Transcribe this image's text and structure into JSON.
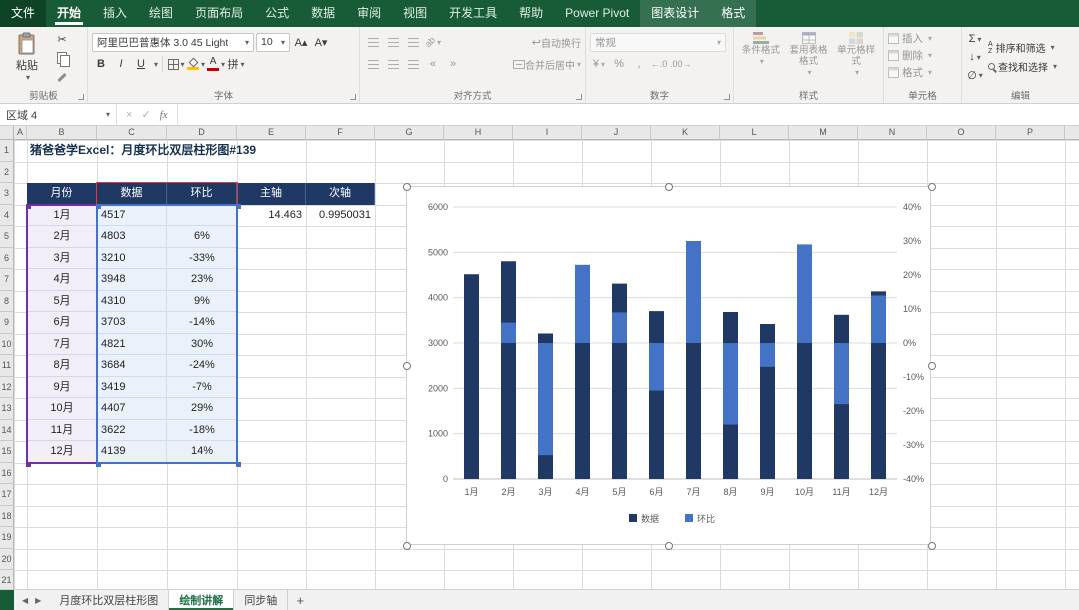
{
  "menu": {
    "tabs": [
      {
        "id": "file",
        "label": "文件"
      },
      {
        "id": "home",
        "label": "开始",
        "selected": true
      },
      {
        "id": "insert",
        "label": "插入"
      },
      {
        "id": "draw",
        "label": "绘图"
      },
      {
        "id": "page-layout",
        "label": "页面布局"
      },
      {
        "id": "formulas",
        "label": "公式"
      },
      {
        "id": "data",
        "label": "数据"
      },
      {
        "id": "review",
        "label": "审阅"
      },
      {
        "id": "view",
        "label": "视图"
      },
      {
        "id": "developer",
        "label": "开发工具"
      },
      {
        "id": "help",
        "label": "帮助"
      },
      {
        "id": "power-pivot",
        "label": "Power Pivot"
      },
      {
        "id": "chart-design",
        "label": "图表设计",
        "context": true
      },
      {
        "id": "format",
        "label": "格式",
        "context": true
      }
    ]
  },
  "ribbon": {
    "clipboard": {
      "group_label": "剪贴板",
      "paste_label": "粘贴"
    },
    "font": {
      "group_label": "字体",
      "font_name": "阿里巴巴普惠体 3.0 45 Light",
      "font_size": "10",
      "bold": "B",
      "italic": "I",
      "underline": "U",
      "phonetic": "拼"
    },
    "alignment": {
      "group_label": "对齐方式",
      "wrap_label": "自动换行",
      "merge_label": "合并后居中",
      "orientation": "ab"
    },
    "number": {
      "group_label": "数字",
      "format_value": "常规",
      "currency": "¥",
      "percent": "%",
      "comma": ",",
      "inc_decimal": "←.0",
      "dec_decimal": ".00→"
    },
    "styles": {
      "group_label": "样式",
      "items": [
        {
          "label": "条件格式"
        },
        {
          "label": "套用表格格式"
        },
        {
          "label": "单元格样式"
        }
      ]
    },
    "cells": {
      "group_label": "单元格",
      "items": [
        {
          "label": "插入"
        },
        {
          "label": "删除"
        },
        {
          "label": "格式"
        }
      ]
    },
    "editing": {
      "group_label": "编辑",
      "sum": "Σ",
      "fill": "↓",
      "clear": "∅",
      "sort_label": "排序和筛选",
      "find_label": "查找和选择"
    },
    "icons": {
      "dropdown": "▾",
      "cut": "✂",
      "wrap": "↩",
      "increase_font": "A▴",
      "decrease_font": "A▾",
      "outdent": "«",
      "indent": "»"
    }
  },
  "formula_bar": {
    "name_box": "区域 4",
    "cancel": "×",
    "enter": "✓",
    "fx_label": "fx"
  },
  "sheet": {
    "col_headers": [
      "A",
      "B",
      "C",
      "D",
      "E",
      "F",
      "G",
      "H",
      "I",
      "J",
      "K",
      "L",
      "M",
      "N",
      "O",
      "P"
    ],
    "visible_rows": 21,
    "title_text": "猪爸爸学Excel：月度环比双层柱形图#139"
  },
  "table": {
    "headers": {
      "month": "月份",
      "value": "数据",
      "mom": "环比",
      "primary": "主轴",
      "secondary": "次轴"
    },
    "rows": [
      {
        "month": "1月",
        "value": "4517",
        "mom": ""
      },
      {
        "month": "2月",
        "value": "4803",
        "mom": "6%"
      },
      {
        "month": "3月",
        "value": "3210",
        "mom": "-33%"
      },
      {
        "month": "4月",
        "value": "3948",
        "mom": "23%"
      },
      {
        "month": "5月",
        "value": "4310",
        "mom": "9%"
      },
      {
        "month": "6月",
        "value": "3703",
        "mom": "-14%"
      },
      {
        "month": "7月",
        "value": "4821",
        "mom": "30%"
      },
      {
        "month": "8月",
        "value": "3684",
        "mom": "-24%"
      },
      {
        "month": "9月",
        "value": "3419",
        "mom": "-7%"
      },
      {
        "month": "10月",
        "value": "4407",
        "mom": "29%"
      },
      {
        "month": "11月",
        "value": "3622",
        "mom": "-18%"
      },
      {
        "month": "12月",
        "value": "4139",
        "mom": "14%"
      }
    ],
    "primary_value": "14.463",
    "secondary_value": "0.9950031"
  },
  "chart_data": {
    "type": "bar",
    "subtype": "dual-axis overlay column (月度环比双层柱形图)",
    "title": "",
    "categories": [
      "1月",
      "2月",
      "3月",
      "4月",
      "5月",
      "6月",
      "7月",
      "8月",
      "9月",
      "10月",
      "11月",
      "12月"
    ],
    "series": [
      {
        "name": "数据",
        "axis": "primary",
        "color": "#1F3864",
        "values": [
          4517,
          4803,
          3210,
          3948,
          4310,
          3703,
          4821,
          3684,
          3419,
          4407,
          3622,
          4139
        ]
      },
      {
        "name": "环比",
        "axis": "secondary",
        "color": "#4472C4",
        "values": [
          null,
          0.06,
          -0.33,
          0.23,
          0.09,
          -0.14,
          0.3,
          -0.24,
          -0.07,
          0.29,
          -0.18,
          0.14
        ]
      }
    ],
    "primary_axis": {
      "min": 0,
      "max": 6000,
      "step": 1000
    },
    "secondary_axis": {
      "min": -0.4,
      "max": 0.4,
      "step": 0.1
    },
    "legend": {
      "position": "bottom",
      "entries": [
        "数据",
        "环比"
      ]
    },
    "gridlines": true
  },
  "sheet_tabs": {
    "tabs": [
      {
        "label": "月度环比双层柱形图",
        "active": false
      },
      {
        "label": "绘制讲解",
        "active": true
      },
      {
        "label": "同步轴",
        "active": false
      }
    ],
    "add_label": "+"
  },
  "colors": {
    "menubar": "#185C37",
    "header_fill": "#1F3864",
    "bar_dark": "#1F3864",
    "bar_light": "#4472C4",
    "highlight_purple": "#7030A0",
    "highlight_blue": "#4472C4",
    "highlight_red": "#E53935",
    "active_tab_green": "#1E7145"
  }
}
